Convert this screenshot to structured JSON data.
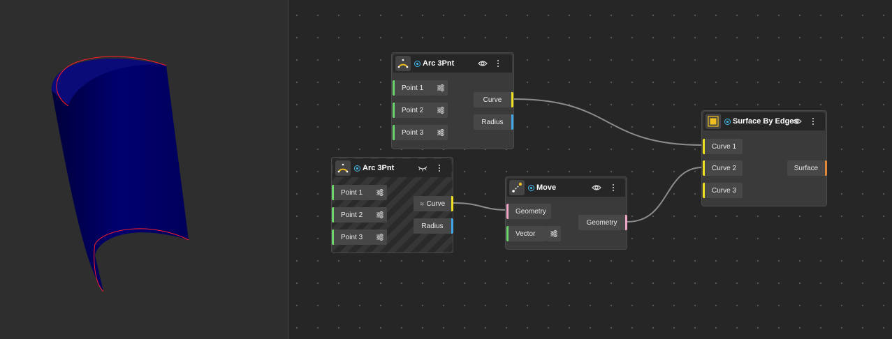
{
  "colors": {
    "background": "#262626",
    "viewport_background": "#2e2e2e",
    "node_body": "#3a3a3a",
    "wire": "#8c8c8c",
    "surface_fill": "#000066",
    "surface_edge": "#ff1e2a",
    "point_port": "#6cd46c",
    "curve_port": "#f0e020",
    "radius_port": "#41a6e6",
    "geometry_port": "#f0a6c6",
    "surface_port": "#e0883a",
    "status": "#41b6e6"
  },
  "nodes": {
    "arc1": {
      "title": "Arc 3Pnt",
      "icon": "arc-icon",
      "visibility_icon": "eye-icon",
      "inputs": [
        "Point 1",
        "Point 2",
        "Point 3"
      ],
      "outputs": [
        "Curve",
        "Radius"
      ]
    },
    "arc2": {
      "title": "Arc 3Pnt",
      "icon": "arc-icon",
      "visibility_icon": "eye-closed-icon",
      "inputs": [
        "Point 1",
        "Point 2",
        "Point 3"
      ],
      "outputs": [
        "Curve",
        "Radius"
      ]
    },
    "move": {
      "title": "Move",
      "icon": "move-icon",
      "visibility_icon": "eye-icon",
      "inputs": [
        "Geometry",
        "Vector"
      ],
      "outputs": [
        "Geometry"
      ]
    },
    "surface": {
      "title": "Surface By Edges",
      "icon": "surface-icon",
      "visibility_icon": "eye-icon",
      "inputs": [
        "Curve 1",
        "Curve 2",
        "Curve 3"
      ],
      "outputs": [
        "Surface"
      ]
    }
  }
}
